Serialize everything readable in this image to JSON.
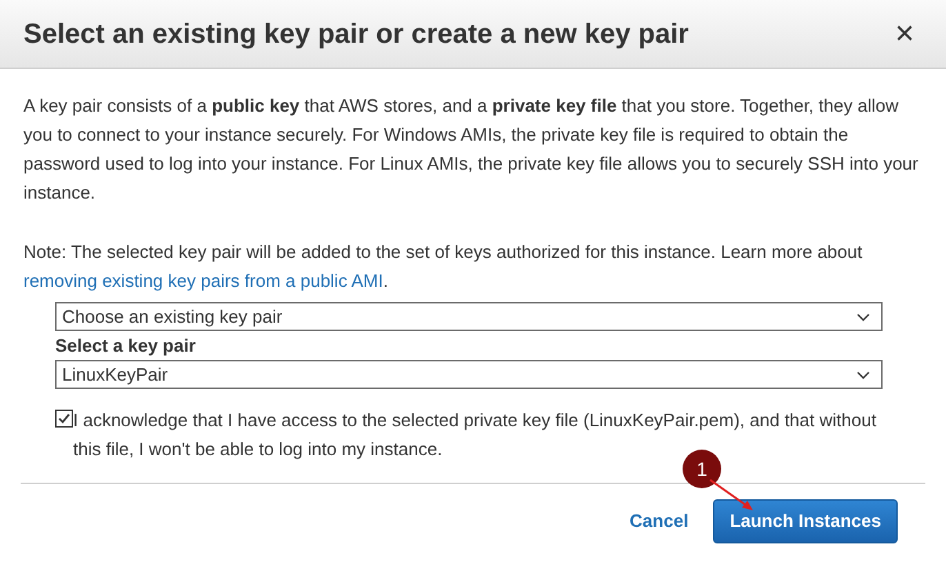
{
  "dialog": {
    "title": "Select an existing key pair or create a new key pair",
    "close": "×",
    "description": "A key pair consists of a **public key** that AWS stores, and a **private key file** that you store. Together, they allow you to connect to your instance securely. For Windows AMIs, the private key file is required to obtain the password used to log into your instance. For Linux AMIs, the private key file allows you to securely SSH into your instance.",
    "note": "Note: The selected key pair will be added to the set of keys authorized for this instance. Learn more about",
    "note_link": "removing existing key pairs from a public AMI",
    "note_end": ".",
    "mode_select": {
      "value": "Choose an existing key pair"
    },
    "key_pair_label": "Select a key pair",
    "key_pair_select": {
      "value": "LinuxKeyPair"
    },
    "acknowledge": {
      "label": "I acknowledge that I have access to the selected private key file (LinuxKeyPair.pem), and that without this file, I won't be able to log into my instance.",
      "checked": true
    },
    "buttons": [
      {
        "label": "Cancel",
        "kind": "link"
      },
      {
        "label": "Launch Instances",
        "kind": "primary"
      }
    ],
    "annotation": {
      "label": "1"
    }
  }
}
